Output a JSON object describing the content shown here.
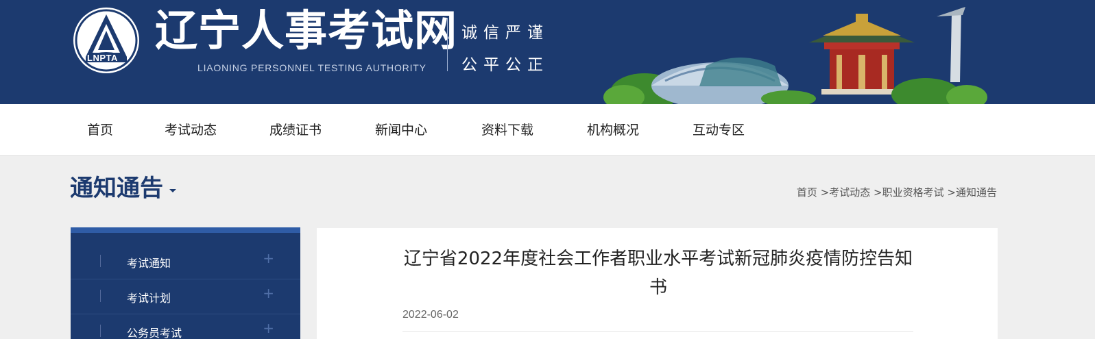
{
  "header": {
    "logo_text": "LNPTA",
    "site_title": "辽宁人事考试网",
    "site_subtitle": "LIAONING PERSONNEL TESTING AUTHORITY",
    "slogan_line1": "诚信严谨",
    "slogan_line2": "公平公正",
    "colors": {
      "background": "#1c3a6f",
      "text": "#ffffff"
    }
  },
  "nav": {
    "items": [
      "首页",
      "考试动态",
      "成绩证书",
      "新闻中心",
      "资料下载",
      "机构概况",
      "互动专区"
    ]
  },
  "page": {
    "section_title": "通知通告",
    "breadcrumb": {
      "home": "首页",
      "sep1": " >",
      "level1": "考试动态",
      "sep2": " >",
      "level2": "职业资格考试",
      "sep3": " >",
      "level3": "通知通告"
    }
  },
  "sidebar": {
    "items": [
      {
        "label": "考试通知",
        "icon": "plus-icon"
      },
      {
        "label": "考试计划",
        "icon": "plus-icon"
      },
      {
        "label": "公务员考试",
        "icon": "plus-icon"
      }
    ],
    "colors": {
      "background": "#1c3a6f",
      "accent": "#2f5ca6"
    }
  },
  "article": {
    "title": "辽宁省2022年度社会工作者职业水平考试新冠肺炎疫情防控告知书",
    "date": "2022-06-02"
  }
}
